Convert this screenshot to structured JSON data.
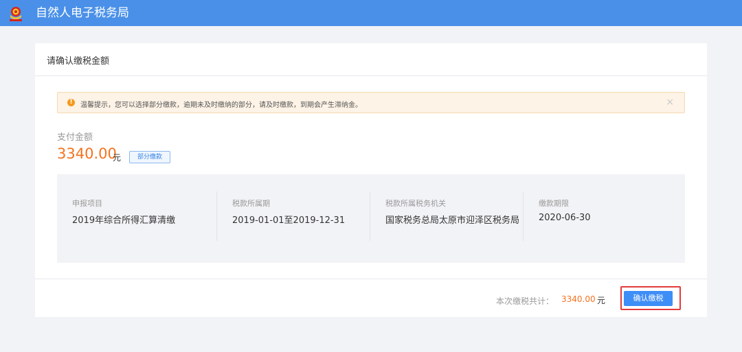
{
  "app": {
    "title": "自然人电子税务局",
    "logo_icon": "tax-emblem-icon"
  },
  "page": {
    "title": "请确认缴税金额"
  },
  "notice": {
    "icon": "warning-icon",
    "text": "温馨提示，您可以选择部分缴款，逾期未及时缴纳的部分，请及时缴款，到期会产生滞纳金。",
    "close_icon": "close-icon",
    "close_symbol": "×"
  },
  "payment": {
    "label": "支付金额",
    "amount": "3340.00",
    "unit": "元",
    "partial_button": "部分缴款"
  },
  "details": [
    {
      "label": "申报项目",
      "value": "2019年综合所得汇算清缴"
    },
    {
      "label": "税款所属期",
      "value": "2019-01-01至2019-12-31"
    },
    {
      "label": "税款所属税务机关",
      "value": "国家税务总局太原市迎泽区税务局"
    },
    {
      "label": "缴款期限",
      "value": "2020-06-30"
    }
  ],
  "footer": {
    "total_label": "本次缴税共计：",
    "total_amount": "3340.00",
    "total_unit": "元",
    "confirm_button": "确认缴税"
  },
  "colors": {
    "header": "#4a90e8",
    "accent_orange": "#f5721e",
    "primary_button": "#3e8ef7",
    "highlight_outline": "#e33a3a"
  }
}
